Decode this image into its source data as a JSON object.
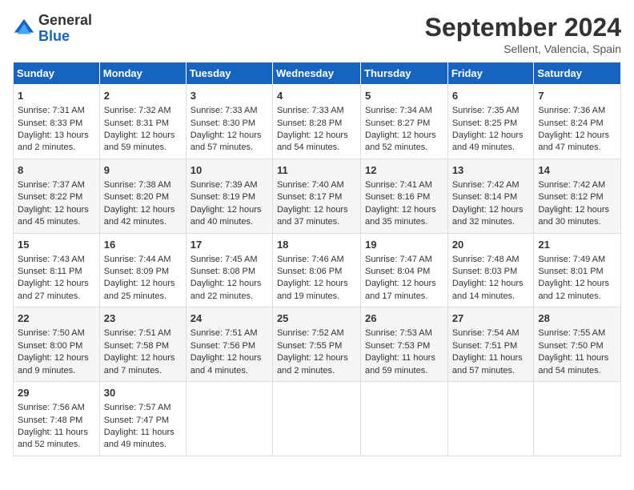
{
  "header": {
    "logo_general": "General",
    "logo_blue": "Blue",
    "month_title": "September 2024",
    "location": "Sellent, Valencia, Spain"
  },
  "calendar": {
    "days_of_week": [
      "Sunday",
      "Monday",
      "Tuesday",
      "Wednesday",
      "Thursday",
      "Friday",
      "Saturday"
    ],
    "weeks": [
      [
        {
          "day": "1",
          "sunrise": "Sunrise: 7:31 AM",
          "sunset": "Sunset: 8:33 PM",
          "daylight": "Daylight: 13 hours and 2 minutes."
        },
        {
          "day": "2",
          "sunrise": "Sunrise: 7:32 AM",
          "sunset": "Sunset: 8:31 PM",
          "daylight": "Daylight: 12 hours and 59 minutes."
        },
        {
          "day": "3",
          "sunrise": "Sunrise: 7:33 AM",
          "sunset": "Sunset: 8:30 PM",
          "daylight": "Daylight: 12 hours and 57 minutes."
        },
        {
          "day": "4",
          "sunrise": "Sunrise: 7:33 AM",
          "sunset": "Sunset: 8:28 PM",
          "daylight": "Daylight: 12 hours and 54 minutes."
        },
        {
          "day": "5",
          "sunrise": "Sunrise: 7:34 AM",
          "sunset": "Sunset: 8:27 PM",
          "daylight": "Daylight: 12 hours and 52 minutes."
        },
        {
          "day": "6",
          "sunrise": "Sunrise: 7:35 AM",
          "sunset": "Sunset: 8:25 PM",
          "daylight": "Daylight: 12 hours and 49 minutes."
        },
        {
          "day": "7",
          "sunrise": "Sunrise: 7:36 AM",
          "sunset": "Sunset: 8:24 PM",
          "daylight": "Daylight: 12 hours and 47 minutes."
        }
      ],
      [
        {
          "day": "8",
          "sunrise": "Sunrise: 7:37 AM",
          "sunset": "Sunset: 8:22 PM",
          "daylight": "Daylight: 12 hours and 45 minutes."
        },
        {
          "day": "9",
          "sunrise": "Sunrise: 7:38 AM",
          "sunset": "Sunset: 8:20 PM",
          "daylight": "Daylight: 12 hours and 42 minutes."
        },
        {
          "day": "10",
          "sunrise": "Sunrise: 7:39 AM",
          "sunset": "Sunset: 8:19 PM",
          "daylight": "Daylight: 12 hours and 40 minutes."
        },
        {
          "day": "11",
          "sunrise": "Sunrise: 7:40 AM",
          "sunset": "Sunset: 8:17 PM",
          "daylight": "Daylight: 12 hours and 37 minutes."
        },
        {
          "day": "12",
          "sunrise": "Sunrise: 7:41 AM",
          "sunset": "Sunset: 8:16 PM",
          "daylight": "Daylight: 12 hours and 35 minutes."
        },
        {
          "day": "13",
          "sunrise": "Sunrise: 7:42 AM",
          "sunset": "Sunset: 8:14 PM",
          "daylight": "Daylight: 12 hours and 32 minutes."
        },
        {
          "day": "14",
          "sunrise": "Sunrise: 7:42 AM",
          "sunset": "Sunset: 8:12 PM",
          "daylight": "Daylight: 12 hours and 30 minutes."
        }
      ],
      [
        {
          "day": "15",
          "sunrise": "Sunrise: 7:43 AM",
          "sunset": "Sunset: 8:11 PM",
          "daylight": "Daylight: 12 hours and 27 minutes."
        },
        {
          "day": "16",
          "sunrise": "Sunrise: 7:44 AM",
          "sunset": "Sunset: 8:09 PM",
          "daylight": "Daylight: 12 hours and 25 minutes."
        },
        {
          "day": "17",
          "sunrise": "Sunrise: 7:45 AM",
          "sunset": "Sunset: 8:08 PM",
          "daylight": "Daylight: 12 hours and 22 minutes."
        },
        {
          "day": "18",
          "sunrise": "Sunrise: 7:46 AM",
          "sunset": "Sunset: 8:06 PM",
          "daylight": "Daylight: 12 hours and 19 minutes."
        },
        {
          "day": "19",
          "sunrise": "Sunrise: 7:47 AM",
          "sunset": "Sunset: 8:04 PM",
          "daylight": "Daylight: 12 hours and 17 minutes."
        },
        {
          "day": "20",
          "sunrise": "Sunrise: 7:48 AM",
          "sunset": "Sunset: 8:03 PM",
          "daylight": "Daylight: 12 hours and 14 minutes."
        },
        {
          "day": "21",
          "sunrise": "Sunrise: 7:49 AM",
          "sunset": "Sunset: 8:01 PM",
          "daylight": "Daylight: 12 hours and 12 minutes."
        }
      ],
      [
        {
          "day": "22",
          "sunrise": "Sunrise: 7:50 AM",
          "sunset": "Sunset: 8:00 PM",
          "daylight": "Daylight: 12 hours and 9 minutes."
        },
        {
          "day": "23",
          "sunrise": "Sunrise: 7:51 AM",
          "sunset": "Sunset: 7:58 PM",
          "daylight": "Daylight: 12 hours and 7 minutes."
        },
        {
          "day": "24",
          "sunrise": "Sunrise: 7:51 AM",
          "sunset": "Sunset: 7:56 PM",
          "daylight": "Daylight: 12 hours and 4 minutes."
        },
        {
          "day": "25",
          "sunrise": "Sunrise: 7:52 AM",
          "sunset": "Sunset: 7:55 PM",
          "daylight": "Daylight: 12 hours and 2 minutes."
        },
        {
          "day": "26",
          "sunrise": "Sunrise: 7:53 AM",
          "sunset": "Sunset: 7:53 PM",
          "daylight": "Daylight: 11 hours and 59 minutes."
        },
        {
          "day": "27",
          "sunrise": "Sunrise: 7:54 AM",
          "sunset": "Sunset: 7:51 PM",
          "daylight": "Daylight: 11 hours and 57 minutes."
        },
        {
          "day": "28",
          "sunrise": "Sunrise: 7:55 AM",
          "sunset": "Sunset: 7:50 PM",
          "daylight": "Daylight: 11 hours and 54 minutes."
        }
      ],
      [
        {
          "day": "29",
          "sunrise": "Sunrise: 7:56 AM",
          "sunset": "Sunset: 7:48 PM",
          "daylight": "Daylight: 11 hours and 52 minutes."
        },
        {
          "day": "30",
          "sunrise": "Sunrise: 7:57 AM",
          "sunset": "Sunset: 7:47 PM",
          "daylight": "Daylight: 11 hours and 49 minutes."
        },
        {
          "day": "",
          "sunrise": "",
          "sunset": "",
          "daylight": ""
        },
        {
          "day": "",
          "sunrise": "",
          "sunset": "",
          "daylight": ""
        },
        {
          "day": "",
          "sunrise": "",
          "sunset": "",
          "daylight": ""
        },
        {
          "day": "",
          "sunrise": "",
          "sunset": "",
          "daylight": ""
        },
        {
          "day": "",
          "sunrise": "",
          "sunset": "",
          "daylight": ""
        }
      ]
    ]
  }
}
